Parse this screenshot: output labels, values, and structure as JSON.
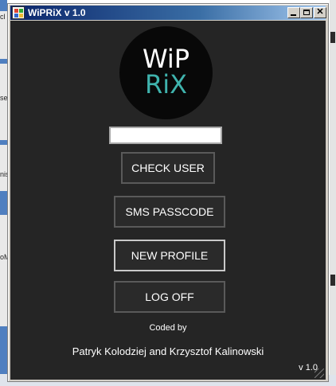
{
  "window": {
    "title": "WiPRiX v 1.0",
    "controls": {
      "minimize": "",
      "maximize": "",
      "close": "✕"
    }
  },
  "logo": {
    "line1": "WiP",
    "line2": "RiX",
    "line2_color": "#3fb3ad"
  },
  "user_input": {
    "value": "",
    "placeholder": ""
  },
  "buttons": {
    "check_user": "CHECK USER",
    "sms_passcode": "SMS PASSCODE",
    "new_profile": "NEW PROFILE",
    "log_off": "LOG OFF"
  },
  "footer": {
    "coded_by": "Coded by",
    "authors": "Patryk Kolodziej and Krzysztof Kalinowski",
    "version": "v 1.0"
  },
  "background": {
    "left_labels": [
      "cl",
      "se",
      "nis",
      "oM"
    ]
  },
  "colors": {
    "client_bg": "#252525",
    "accent": "#3fb3ad",
    "title_bar": "#0a246a"
  }
}
